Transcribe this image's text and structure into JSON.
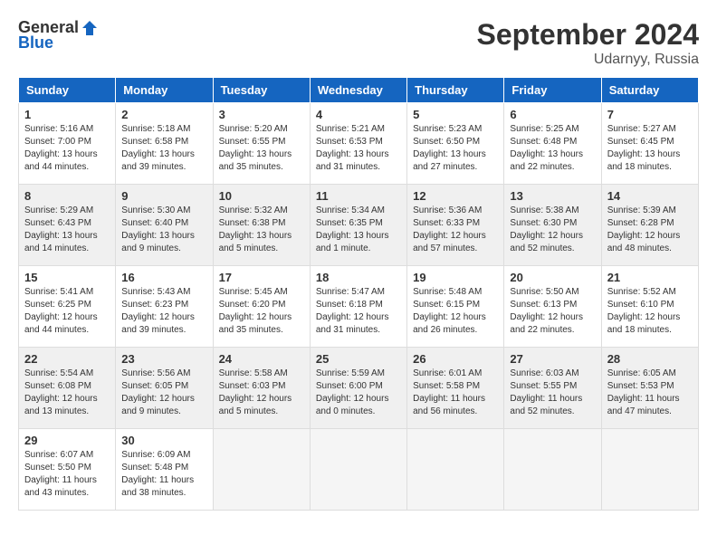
{
  "header": {
    "logo_general": "General",
    "logo_blue": "Blue",
    "month_title": "September 2024",
    "location": "Udarnyy, Russia"
  },
  "weekdays": [
    "Sunday",
    "Monday",
    "Tuesday",
    "Wednesday",
    "Thursday",
    "Friday",
    "Saturday"
  ],
  "weeks": [
    [
      {
        "day": "1",
        "info": "Sunrise: 5:16 AM\nSunset: 7:00 PM\nDaylight: 13 hours\nand 44 minutes."
      },
      {
        "day": "2",
        "info": "Sunrise: 5:18 AM\nSunset: 6:58 PM\nDaylight: 13 hours\nand 39 minutes."
      },
      {
        "day": "3",
        "info": "Sunrise: 5:20 AM\nSunset: 6:55 PM\nDaylight: 13 hours\nand 35 minutes."
      },
      {
        "day": "4",
        "info": "Sunrise: 5:21 AM\nSunset: 6:53 PM\nDaylight: 13 hours\nand 31 minutes."
      },
      {
        "day": "5",
        "info": "Sunrise: 5:23 AM\nSunset: 6:50 PM\nDaylight: 13 hours\nand 27 minutes."
      },
      {
        "day": "6",
        "info": "Sunrise: 5:25 AM\nSunset: 6:48 PM\nDaylight: 13 hours\nand 22 minutes."
      },
      {
        "day": "7",
        "info": "Sunrise: 5:27 AM\nSunset: 6:45 PM\nDaylight: 13 hours\nand 18 minutes."
      }
    ],
    [
      {
        "day": "8",
        "info": "Sunrise: 5:29 AM\nSunset: 6:43 PM\nDaylight: 13 hours\nand 14 minutes."
      },
      {
        "day": "9",
        "info": "Sunrise: 5:30 AM\nSunset: 6:40 PM\nDaylight: 13 hours\nand 9 minutes."
      },
      {
        "day": "10",
        "info": "Sunrise: 5:32 AM\nSunset: 6:38 PM\nDaylight: 13 hours\nand 5 minutes."
      },
      {
        "day": "11",
        "info": "Sunrise: 5:34 AM\nSunset: 6:35 PM\nDaylight: 13 hours\nand 1 minute."
      },
      {
        "day": "12",
        "info": "Sunrise: 5:36 AM\nSunset: 6:33 PM\nDaylight: 12 hours\nand 57 minutes."
      },
      {
        "day": "13",
        "info": "Sunrise: 5:38 AM\nSunset: 6:30 PM\nDaylight: 12 hours\nand 52 minutes."
      },
      {
        "day": "14",
        "info": "Sunrise: 5:39 AM\nSunset: 6:28 PM\nDaylight: 12 hours\nand 48 minutes."
      }
    ],
    [
      {
        "day": "15",
        "info": "Sunrise: 5:41 AM\nSunset: 6:25 PM\nDaylight: 12 hours\nand 44 minutes."
      },
      {
        "day": "16",
        "info": "Sunrise: 5:43 AM\nSunset: 6:23 PM\nDaylight: 12 hours\nand 39 minutes."
      },
      {
        "day": "17",
        "info": "Sunrise: 5:45 AM\nSunset: 6:20 PM\nDaylight: 12 hours\nand 35 minutes."
      },
      {
        "day": "18",
        "info": "Sunrise: 5:47 AM\nSunset: 6:18 PM\nDaylight: 12 hours\nand 31 minutes."
      },
      {
        "day": "19",
        "info": "Sunrise: 5:48 AM\nSunset: 6:15 PM\nDaylight: 12 hours\nand 26 minutes."
      },
      {
        "day": "20",
        "info": "Sunrise: 5:50 AM\nSunset: 6:13 PM\nDaylight: 12 hours\nand 22 minutes."
      },
      {
        "day": "21",
        "info": "Sunrise: 5:52 AM\nSunset: 6:10 PM\nDaylight: 12 hours\nand 18 minutes."
      }
    ],
    [
      {
        "day": "22",
        "info": "Sunrise: 5:54 AM\nSunset: 6:08 PM\nDaylight: 12 hours\nand 13 minutes."
      },
      {
        "day": "23",
        "info": "Sunrise: 5:56 AM\nSunset: 6:05 PM\nDaylight: 12 hours\nand 9 minutes."
      },
      {
        "day": "24",
        "info": "Sunrise: 5:58 AM\nSunset: 6:03 PM\nDaylight: 12 hours\nand 5 minutes."
      },
      {
        "day": "25",
        "info": "Sunrise: 5:59 AM\nSunset: 6:00 PM\nDaylight: 12 hours\nand 0 minutes."
      },
      {
        "day": "26",
        "info": "Sunrise: 6:01 AM\nSunset: 5:58 PM\nDaylight: 11 hours\nand 56 minutes."
      },
      {
        "day": "27",
        "info": "Sunrise: 6:03 AM\nSunset: 5:55 PM\nDaylight: 11 hours\nand 52 minutes."
      },
      {
        "day": "28",
        "info": "Sunrise: 6:05 AM\nSunset: 5:53 PM\nDaylight: 11 hours\nand 47 minutes."
      }
    ],
    [
      {
        "day": "29",
        "info": "Sunrise: 6:07 AM\nSunset: 5:50 PM\nDaylight: 11 hours\nand 43 minutes."
      },
      {
        "day": "30",
        "info": "Sunrise: 6:09 AM\nSunset: 5:48 PM\nDaylight: 11 hours\nand 38 minutes."
      },
      {
        "day": "",
        "info": ""
      },
      {
        "day": "",
        "info": ""
      },
      {
        "day": "",
        "info": ""
      },
      {
        "day": "",
        "info": ""
      },
      {
        "day": "",
        "info": ""
      }
    ]
  ]
}
